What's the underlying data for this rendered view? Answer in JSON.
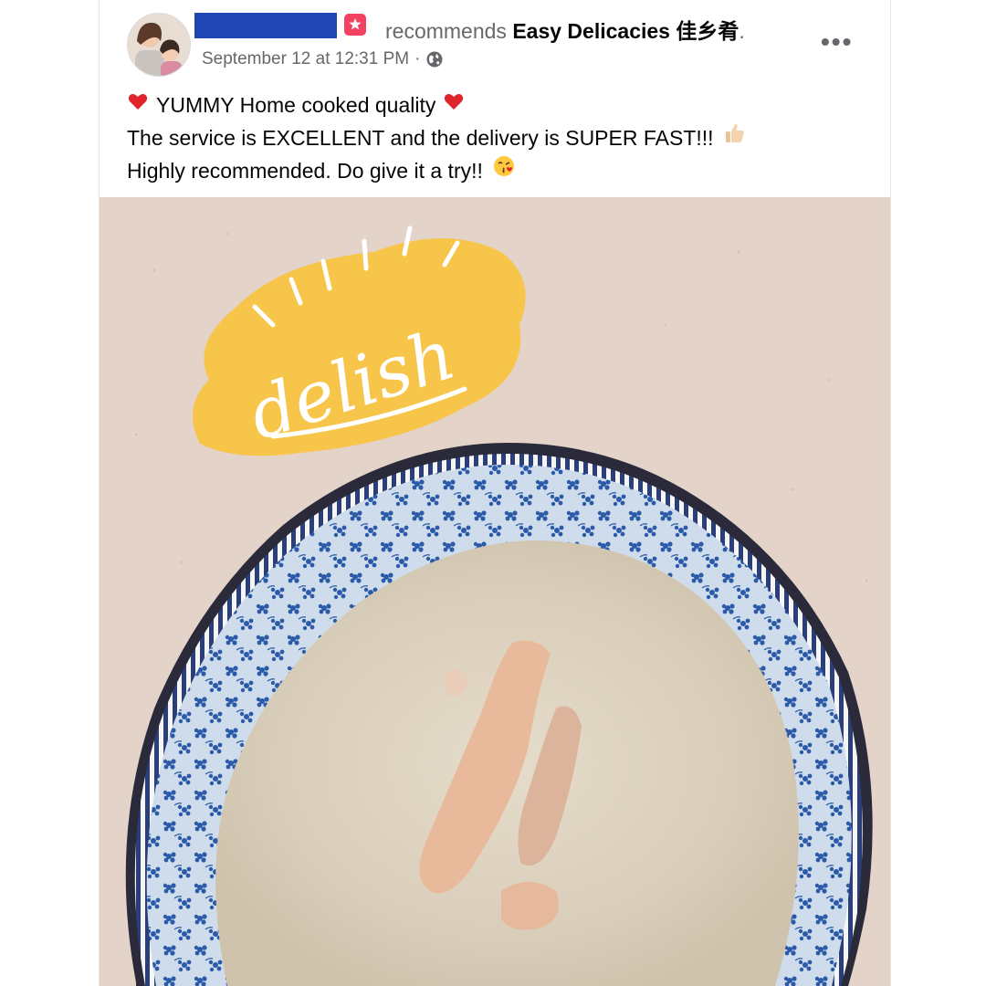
{
  "post": {
    "recommends_label": "recommends",
    "page_name": "Easy Delicacies 佳乡肴",
    "page_name_suffix": ".",
    "timestamp": "September 12 at 12:31 PM",
    "separator": "·",
    "more_label": "•••",
    "text_line_1": "YUMMY Home cooked quality",
    "text_line_2": "The service is EXCELLENT and the delivery is SUPER FAST!!!",
    "text_line_3": "Highly recommended. Do give it a try!!"
  },
  "photo": {
    "sticker_text": "delish"
  },
  "icons": {
    "heart": "red-heart-icon",
    "thumbs_up": "thumbs-up-icon",
    "kiss": "kissing-face-icon",
    "globe": "globe-icon",
    "recommend": "recommend-star-icon"
  },
  "colors": {
    "name_redaction": "#1f46b3",
    "recommend_badge": "#f3425f",
    "sticker": "#f7c54a",
    "plate_pattern": "#2b5aa8"
  }
}
